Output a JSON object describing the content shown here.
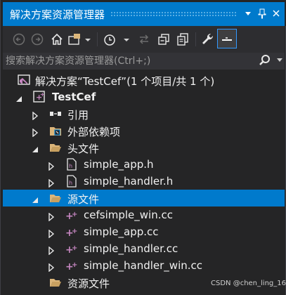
{
  "titlebar": {
    "title": "解决方案资源管理器",
    "dropdown_icon": "chevron-down-icon",
    "pin_icon": "pin-icon",
    "close_icon": "close-icon"
  },
  "toolbar": {
    "icons": [
      "back-icon",
      "forward-icon",
      "home-icon",
      "switch-views-icon",
      "pending-changes-filter-icon",
      "sync-icon",
      "collapse-all-icon",
      "show-all-files-icon",
      "properties-icon",
      "preview-icon"
    ]
  },
  "search": {
    "placeholder": "搜索解决方案资源管理器(Ctrl+;)"
  },
  "tree": {
    "solution": "解决方案“TestCef”(1 个项目/共 1 个)",
    "project": "TestCef",
    "references": "引用",
    "external_deps": "外部依赖项",
    "header_files": "头文件",
    "simple_app_h": "simple_app.h",
    "simple_handler_h": "simple_handler.h",
    "source_files": "源文件",
    "cefsimple_win_cc": "cefsimple_win.cc",
    "simple_app_cc": "simple_app.cc",
    "simple_handler_cc": "simple_handler.cc",
    "simple_handler_win_cc": "simple_handler_win.cc",
    "resource_files": "资源文件"
  },
  "colors": {
    "accent": "#007acc",
    "background": "#252526",
    "folder": "#dcb67a",
    "cpp": "#c586c0"
  },
  "watermark": "CSDN @chen_ling_16"
}
